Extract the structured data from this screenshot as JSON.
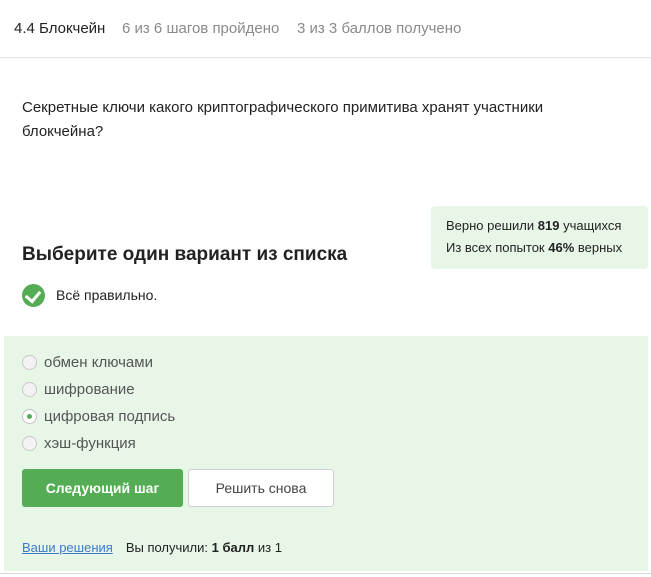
{
  "header": {
    "lesson": "4.4 Блокчейн",
    "steps_progress": "6 из 6 шагов пройдено",
    "points_progress": "3 из 3 баллов  получено"
  },
  "question": {
    "text": "Секретные ключи какого криптографического примитива хранят участники блокчейна?"
  },
  "stats": {
    "solved_prefix": "Верно решили ",
    "solved_count": "819",
    "solved_suffix": " учащихся",
    "attempts_prefix": "Из всех попыток ",
    "attempts_percent": "46%",
    "attempts_suffix": " верных"
  },
  "task": {
    "title": "Выберите один вариант из списка",
    "result_text": "Всё правильно."
  },
  "options": [
    {
      "label": "обмен ключами",
      "selected": false
    },
    {
      "label": "шифрование",
      "selected": false
    },
    {
      "label": "цифровая подпись",
      "selected": true
    },
    {
      "label": "хэш-функция",
      "selected": false
    }
  ],
  "buttons": {
    "next_label": "Следующий шаг",
    "retry_label": "Решить снова"
  },
  "footer": {
    "solutions_link": "Ваши решения",
    "score_prefix": "Вы получили: ",
    "score_value": "1 балл",
    "score_suffix": " из 1"
  },
  "colors": {
    "accent_green": "#54ad54",
    "panel_background": "#e8f6e8",
    "link_blue": "#3b7bc9"
  }
}
